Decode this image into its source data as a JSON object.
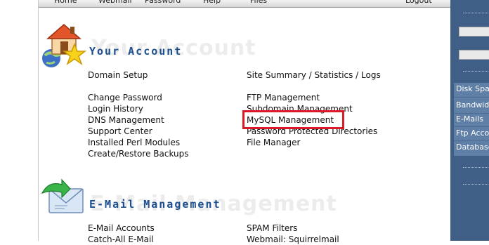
{
  "topnav": {
    "items": [
      "Home",
      "Webmail",
      "Password",
      "Help",
      "Files",
      "Logout"
    ]
  },
  "account_section": {
    "title": "Your Account",
    "watermark": "Your Account",
    "left_links": [
      "Domain Setup",
      "Change Password",
      "Login History",
      "DNS Management",
      "Support Center",
      "Installed Perl Modules",
      "Create/Restore Backups"
    ],
    "right_links": [
      "Site Summary / Statistics / Logs",
      "FTP Management",
      "Subdomain Management",
      "MySQL Management",
      "Password Protected Directories",
      "File Manager"
    ]
  },
  "email_section": {
    "title": "E-Mail Management",
    "watermark": "E-Mail Management",
    "left_links": [
      "E-Mail Accounts",
      "Catch-All E-Mail"
    ],
    "right_links": [
      "SPAM Filters",
      "Webmail: Squirrelmail"
    ]
  },
  "right_panel": {
    "items": [
      "Disk Space",
      "Bandwidth",
      "E-Mails",
      "Ftp Accounts",
      "Databases"
    ]
  },
  "colors": {
    "title_blue": "#1b4f8f",
    "highlight_red": "#d81b24",
    "panel_blue": "#3f5f86"
  }
}
